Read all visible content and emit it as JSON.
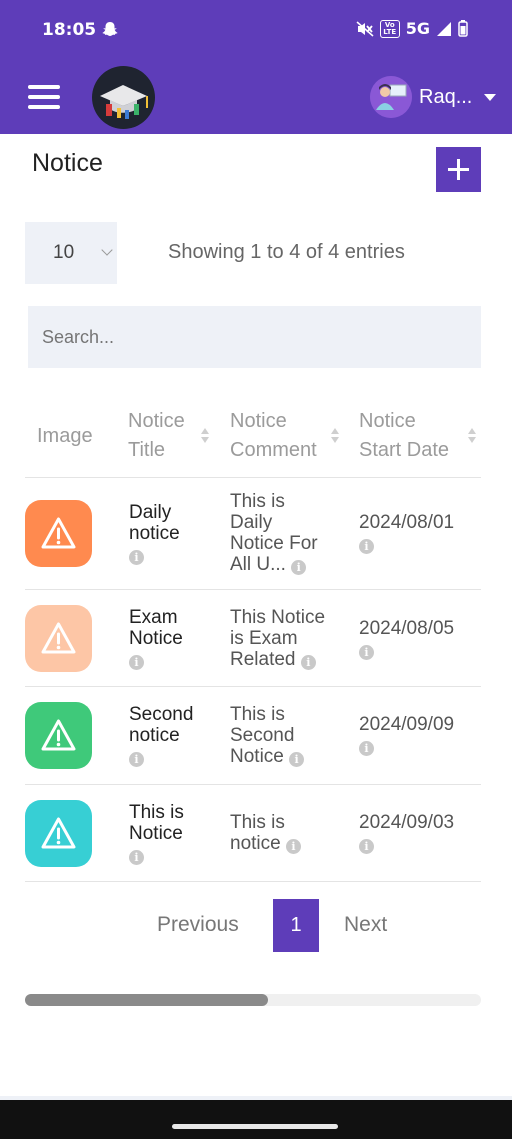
{
  "status_bar": {
    "time": "18:05",
    "network": "5G",
    "volte": "Vo LTE"
  },
  "app_bar": {
    "user_name": "Raq..."
  },
  "page": {
    "title": "Notice"
  },
  "table_controls": {
    "page_length": "10",
    "showing_info": "Showing 1 to 4 of 4 entries",
    "search_placeholder": "Search..."
  },
  "table": {
    "headers": {
      "image": "Image",
      "notice_title_1": "Notice",
      "notice_title_2": "Title",
      "notice_comment_1": "Notice",
      "notice_comment_2": "Comment",
      "notice_start_1": "Notice",
      "notice_start_2": "Start Date"
    },
    "rows": [
      {
        "title_1": "Daily",
        "title_2": "notice",
        "comment_1": "This is",
        "comment_2": "Daily",
        "comment_3": "Notice For",
        "comment_4": "All U...",
        "date": "2024/08/01",
        "icon_color": "#ff8a4f"
      },
      {
        "title_1": "Exam",
        "title_2": "Notice",
        "comment_1": "This Notice",
        "comment_2": "is Exam",
        "comment_3": "Related",
        "date": "2024/08/05",
        "icon_color": "#fdc6a6"
      },
      {
        "title_1": "Second",
        "title_2": "notice",
        "comment_1": "This is",
        "comment_2": "Second",
        "comment_3": "Notice",
        "date": "2024/09/09",
        "icon_color": "#3fc97a"
      },
      {
        "title_1": "This is",
        "title_2": "Notice",
        "comment_1": "This is",
        "comment_2": "notice",
        "date": "2024/09/03",
        "icon_color": "#37cfd4"
      }
    ]
  },
  "pagination": {
    "previous": "Previous",
    "current": "1",
    "next": "Next"
  },
  "colors": {
    "primary": "#5e3db9"
  }
}
